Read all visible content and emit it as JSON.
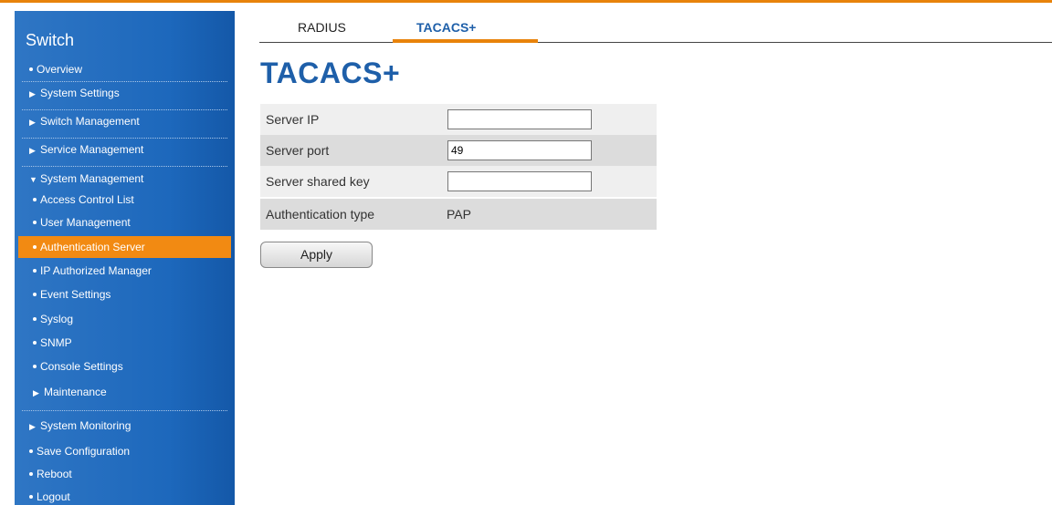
{
  "sidebar": {
    "title": "Switch",
    "items": [
      {
        "label": "Overview"
      },
      {
        "label": "System Settings"
      },
      {
        "label": "Switch Management"
      },
      {
        "label": "Service Management"
      },
      {
        "label": "System Management"
      },
      {
        "label": "Access Control List"
      },
      {
        "label": "User Management"
      },
      {
        "label": "Authentication Server"
      },
      {
        "label": "IP Authorized Manager"
      },
      {
        "label": "Event Settings"
      },
      {
        "label": "Syslog"
      },
      {
        "label": "SNMP"
      },
      {
        "label": "Console Settings"
      },
      {
        "label": "Maintenance"
      },
      {
        "label": "System Monitoring"
      },
      {
        "label": "Save Configuration"
      },
      {
        "label": "Reboot"
      },
      {
        "label": "Logout"
      }
    ]
  },
  "tabs": {
    "radius": "RADIUS",
    "tacacs": "TACACS+"
  },
  "page_title": "TACACS+",
  "form": {
    "server_ip_label": "Server IP",
    "server_ip_value": "",
    "server_port_label": "Server port",
    "server_port_value": "49",
    "shared_key_label": "Server shared key",
    "shared_key_value": "",
    "auth_type_label": "Authentication type",
    "auth_type_value": "PAP"
  },
  "apply_label": "Apply",
  "colors": {
    "accent": "#e8830b",
    "sidebar": "#1d68bc",
    "title": "#1e5fa9"
  }
}
